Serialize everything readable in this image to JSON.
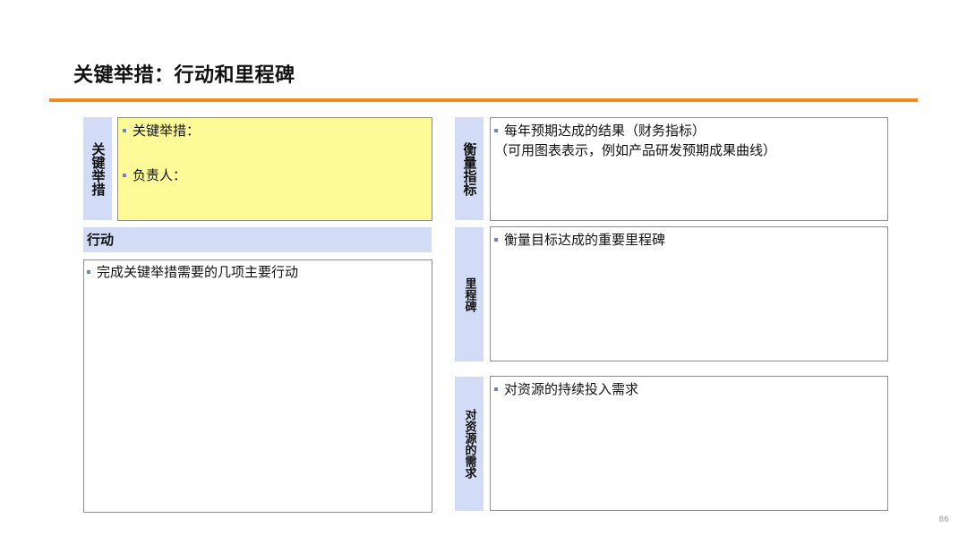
{
  "slide": {
    "title": "关键举措：行动和里程碑",
    "page_number": "86"
  },
  "key_initiative": {
    "label": "关键举措",
    "items": [
      "关键举措：",
      "负责人："
    ]
  },
  "actions": {
    "header": "行动",
    "items": [
      "完成关键举措需要的几项主要行动"
    ]
  },
  "metrics": {
    "label": "衡量指标",
    "bullet": "每年预期达成的结果（财务指标）",
    "note": "（可用图表表示，例如产品研发预期成果曲线）"
  },
  "milestones": {
    "label": "里程碑",
    "bullet": "衡量目标达成的重要里程碑"
  },
  "resources": {
    "label": "对资源的需求",
    "bullet": "对资源的持续投入需求"
  },
  "colors": {
    "accent_orange": "#f08a1c",
    "label_blue": "#d3dcf6",
    "highlight_yellow": "#fdfb97",
    "bullet_blue": "#6f84c4"
  }
}
